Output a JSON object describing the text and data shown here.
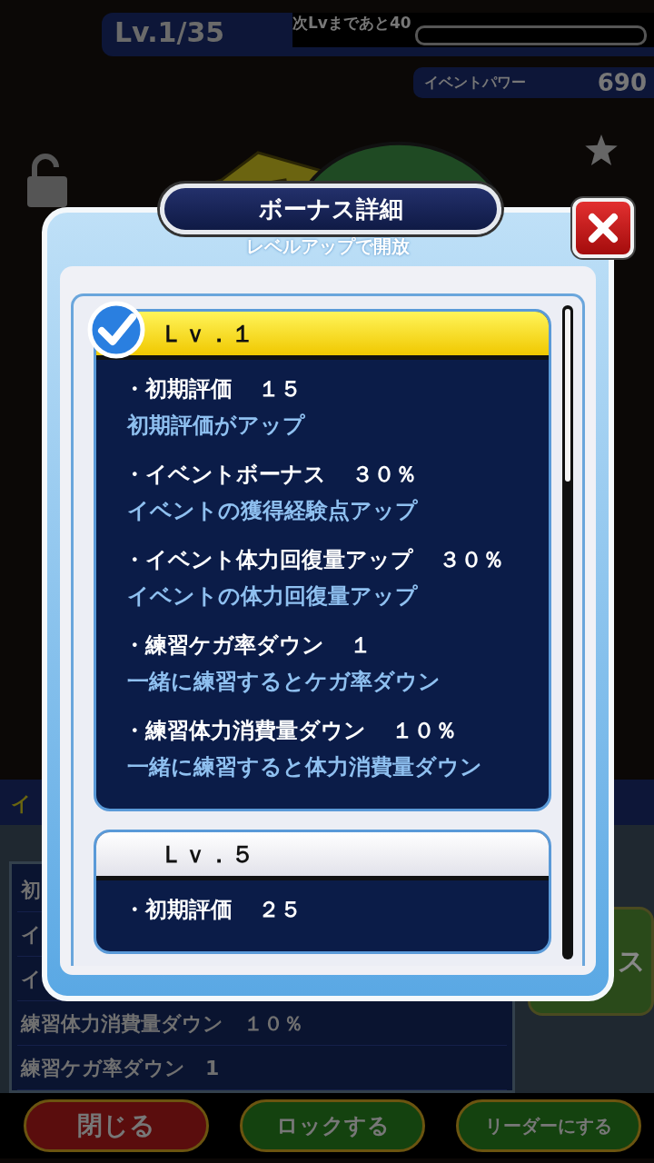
{
  "status": {
    "level": "Lv.1/35",
    "next_level": "次Lvまであと40",
    "event_power_label": "イベントパワー",
    "event_power": "690"
  },
  "background_panel": {
    "header": "イ",
    "rows": [
      "初",
      "イ",
      "イ",
      "練習体力消費量ダウン　１０％",
      "練習ケガ率ダウン　1"
    ],
    "side_button": "ス"
  },
  "bottom_buttons": [
    {
      "label": "閉じる",
      "kind": "red"
    },
    {
      "label": "ロックする",
      "kind": "green"
    },
    {
      "label": "リーダーにする",
      "kind": "green"
    }
  ],
  "dialog": {
    "title": "ボーナス詳細",
    "subtitle": "レベルアップで開放",
    "levels": [
      {
        "label": "Ｌｖ．１",
        "unlocked": true,
        "bonuses": [
          {
            "name": "・初期評価",
            "value": "１５",
            "description": "初期評価がアップ"
          },
          {
            "name": "・イベントボーナス",
            "value": "３０％",
            "description": "イベントの獲得経験点アップ"
          },
          {
            "name": "・イベント体力回復量アップ",
            "value": "３０％",
            "description": "イベントの体力回復量アップ"
          },
          {
            "name": "・練習ケガ率ダウン",
            "value": "１",
            "description": "一緒に練習するとケガ率ダウン"
          },
          {
            "name": "・練習体力消費量ダウン",
            "value": "１０％",
            "description": "一緒に練習すると体力消費量ダウン"
          }
        ]
      },
      {
        "label": "Ｌｖ．５",
        "unlocked": false,
        "bonuses": [
          {
            "name": "・初期評価",
            "value": "２５"
          }
        ]
      }
    ]
  }
}
